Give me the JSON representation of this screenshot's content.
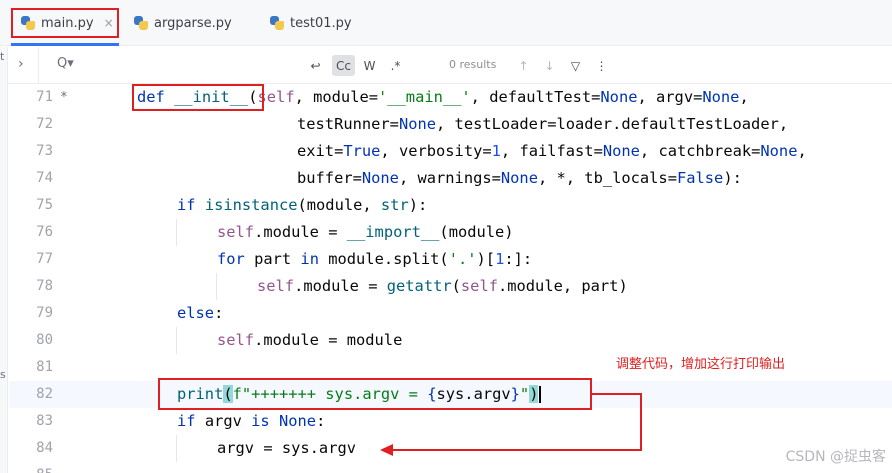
{
  "tabs": [
    {
      "label": "main.py",
      "close": "×"
    },
    {
      "label": "argparse.py"
    },
    {
      "label": "test01.py"
    }
  ],
  "findbar": {
    "expand": "›",
    "search": "Q▾",
    "btn_newline": "↩",
    "btn_case": "Cc",
    "btn_words": "W",
    "btn_regex": ".*",
    "results": "0 results",
    "up": "↑",
    "down": "↓",
    "filter": "▽",
    "more": "⋮"
  },
  "edge_text": {
    "top": "t",
    "mid": "s"
  },
  "lines": [
    {
      "no": "71",
      "mark": "*"
    },
    {
      "no": "72"
    },
    {
      "no": "73"
    },
    {
      "no": "74"
    },
    {
      "no": "75"
    },
    {
      "no": "76"
    },
    {
      "no": "77"
    },
    {
      "no": "78"
    },
    {
      "no": "79"
    },
    {
      "no": "80"
    },
    {
      "no": "81"
    },
    {
      "no": "82"
    },
    {
      "no": "83"
    },
    {
      "no": "84"
    },
    {
      "no": "85"
    }
  ],
  "code": {
    "l71": {
      "def": "def",
      "name": "__init__",
      "open": "(",
      "self": "self",
      "a": ", module=",
      "s1": "'__main__'",
      "b": ", defaultTest=",
      "n1": "None",
      "c": ", argv=",
      "n2": "None",
      "d": ","
    },
    "l72": {
      "a": "testRunner=",
      "n1": "None",
      "b": ", testLoader=loader.defaultTestLoader,"
    },
    "l73": {
      "a": "exit=",
      "t": "True",
      "b": ", verbosity=",
      "one": "1",
      "c": ", failfast=",
      "n1": "None",
      "d": ", catchbreak=",
      "n2": "None",
      "e": ","
    },
    "l74": {
      "a": "buffer=",
      "n1": "None",
      "b": ", warnings=",
      "n2": "None",
      "c": ", *, tb_locals=",
      "f": "False",
      "d": "):"
    },
    "l75": {
      "kw": "if",
      "fn": "isinstance",
      "a": "(module, ",
      "str": "str",
      "b": "):"
    },
    "l76": {
      "self": "self",
      "a": ".module = ",
      "fn": "__import__",
      "b": "(module)"
    },
    "l77": {
      "kw": "for",
      "a": " part ",
      "kw2": "in",
      "b": " module.split(",
      "s": "'.'",
      "c": ")[",
      "one": "1",
      "d": ":]:"
    },
    "l78": {
      "self": "self",
      "a": ".module = ",
      "fn": "getattr",
      "b": "(",
      "self2": "self",
      "c": ".module, part)"
    },
    "l79": {
      "kw": "else",
      "a": ":"
    },
    "l80": {
      "self": "self",
      "a": ".module = module"
    },
    "l82": {
      "fn": "print",
      "open": "(",
      "s": "f\"+++++++ sys.argv = ",
      "b1": "{",
      "expr": "sys.argv",
      "b2": "}",
      "s2": "\"",
      "close": ")"
    },
    "l83": {
      "kw": "if",
      "a": " argv ",
      "kw2": "is",
      "sp": " ",
      "n": "None",
      "b": ":"
    },
    "l84": {
      "a": "argv = sys.argv"
    }
  },
  "annotation": "调整代码，增加这行打印输出",
  "watermark": "CSDN @捉虫客",
  "colors": {
    "annotation": "#e02020",
    "keyword": "#0033b3",
    "string": "#067d17",
    "self": "#94558d",
    "builtin": "#00627a",
    "number": "#1750eb"
  }
}
